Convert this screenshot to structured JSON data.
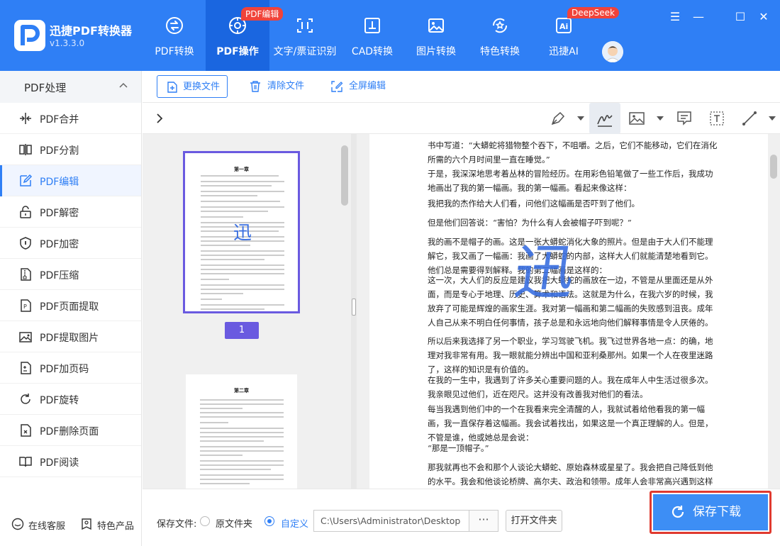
{
  "app": {
    "name": "迅捷PDF转换器",
    "version": "v1.3.3.0"
  },
  "nav": {
    "tabs": [
      {
        "label": "PDF转换",
        "icon": "pdf-convert-icon"
      },
      {
        "label": "PDF操作",
        "icon": "pdf-gear-icon",
        "badge": "PDF编辑",
        "active": true
      },
      {
        "label": "文字/票证识别",
        "icon": "text-scan-icon"
      },
      {
        "label": "CAD转换",
        "icon": "cad-icon"
      },
      {
        "label": "图片转换",
        "icon": "image-icon"
      },
      {
        "label": "特色转换",
        "icon": "star-convert-icon"
      },
      {
        "label": "迅捷AI",
        "icon": "ai-icon",
        "badge": "DeepSeek"
      }
    ]
  },
  "window_controls": {
    "menu": "☰",
    "minimize": "—",
    "maximize": "☐",
    "close": "✕"
  },
  "sidebar": {
    "header": "PDF处理",
    "items": [
      {
        "label": "PDF合并",
        "icon": "merge-icon"
      },
      {
        "label": "PDF分割",
        "icon": "split-icon"
      },
      {
        "label": "PDF编辑",
        "icon": "edit-icon",
        "active": true
      },
      {
        "label": "PDF解密",
        "icon": "unlock-icon"
      },
      {
        "label": "PDF加密",
        "icon": "shield-icon"
      },
      {
        "label": "PDF压缩",
        "icon": "compress-icon"
      },
      {
        "label": "PDF页面提取",
        "icon": "page-extract-icon"
      },
      {
        "label": "PDF提取图片",
        "icon": "image-extract-icon"
      },
      {
        "label": "PDF加页码",
        "icon": "page-number-icon"
      },
      {
        "label": "PDF旋转",
        "icon": "rotate-icon"
      },
      {
        "label": "PDF删除页面",
        "icon": "delete-page-icon"
      },
      {
        "label": "PDF阅读",
        "icon": "book-icon"
      }
    ],
    "footer": {
      "service": "在线客服",
      "products": "特色产品"
    }
  },
  "toolbar": {
    "replace_file": "更换文件",
    "clear_files": "清除文件",
    "fullscreen_edit": "全屏编辑"
  },
  "thumbnails": {
    "selected_page_number": "1",
    "page1_title": "第一章",
    "page2_title": "第二章",
    "signature_text": "迅"
  },
  "document": {
    "signature_text": "迅",
    "paragraphs": [
      "书中写道：“大蟒蛇将猎物整个吞下，不咀嚼。之后，它们不能移动，它们在消化所需的六个月时间里一直在睡觉。”",
      "于是，我深深地思考着丛林的冒险经历。在用彩色铅笔做了一些工作后，我成功地画出了我的第一幅画。我的第一幅画。看起来像这样：",
      "我把我的杰作给大人们看，问他们这幅画是否吓到了他们。",
      "但是他们回答说：“害怕？为什么有人会被帽子吓到呢？”",
      "我的画不是帽子的画。这是一张大蟒蛇消化大象的照片。但是由于大人们不能理解它，我又画了一幅画：我画了大蟒蛇的内部，这样大人们就能清楚地看到它。他们总是需要得到解释。我的第二幅画是这样的：",
      "这一次，大人们的反应是建议我把大蟒蛇的画放在一边，不管是从里面还是从外面，而是专心于地理、历史、算术和语法。这就是为什么，在我六岁的时候，我放弃了可能是辉煌的画家生涯。我对第一幅画和第二幅画的失败感到沮丧。成年人自己从来不明白任何事情，孩子总是和永远地向他们解释事情是令人厌倦的。",
      "所以后来我选择了另一个职业，学习驾驶飞机。我飞过世界各地一点：的确，地理对我非常有用。我一眼就能分辨出中国和亚利桑那州。如果一个人在夜里迷路了，这样的知识是有价值的。",
      "在我的一生中，我遇到了许多关心重要问题的人。我在成年人中生活过很多次。我亲眼见过他们，近在咫尺。这并没有改善我对他们的看法。",
      "每当我遇到他们中的一个在我看来完全清醒的人，我就试着给他看我的第一幅画，我一直保存着这幅画。我会试着找出，如果这是一个真正理解的人。但是，不管是谁，他或她总是会说：",
      "“那是一顶帽子。”",
      "那我就再也不会和那个人谈论大蟒蛇、原始森林或星星了。我会把自己降低到他的水平。我会和他谈论桥牌、高尔夫、政治和领带。成年人会非常高兴遇到这样一个明智的人。"
    ]
  },
  "bottom": {
    "save_label": "保存文件:",
    "option_original": "原文件夹",
    "option_custom": "自定义",
    "path_value": "C:\\Users\\Administrator\\Desktop",
    "browse": "···",
    "open_folder": "打开文件夹",
    "save_download": "保存下载"
  },
  "colors": {
    "primary": "#2f7ff5",
    "active_tab": "#1a66e0",
    "badge": "#f0433a",
    "signature": "#3a6fe0",
    "highlight_border": "#e03a2f"
  }
}
